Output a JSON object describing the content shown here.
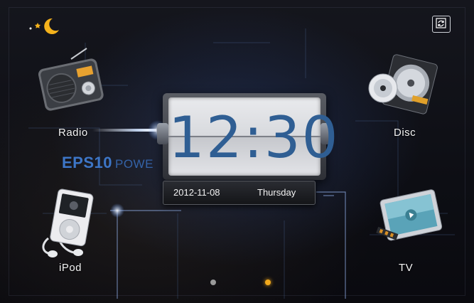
{
  "apps": {
    "radio": {
      "label": "Radio"
    },
    "disc": {
      "label": "Disc"
    },
    "ipod": {
      "label": "iPod"
    },
    "tv": {
      "label": "TV"
    }
  },
  "watermark": {
    "brand": "EPS10",
    "suffix": "POWE"
  },
  "clock": {
    "time": "12:30",
    "date": "2012-11-08",
    "day": "Thursday"
  },
  "pager": {
    "active_page": 2,
    "total_pages": 2
  },
  "colors": {
    "accent": "#3d76c7",
    "clock_digits": "#2f5e93",
    "active_dot": "#f2a91c",
    "inactive_dot": "#9a9a9a"
  },
  "icons": {
    "night_mode": "moon-stars-icon",
    "switch": "switch-screen-icon"
  }
}
